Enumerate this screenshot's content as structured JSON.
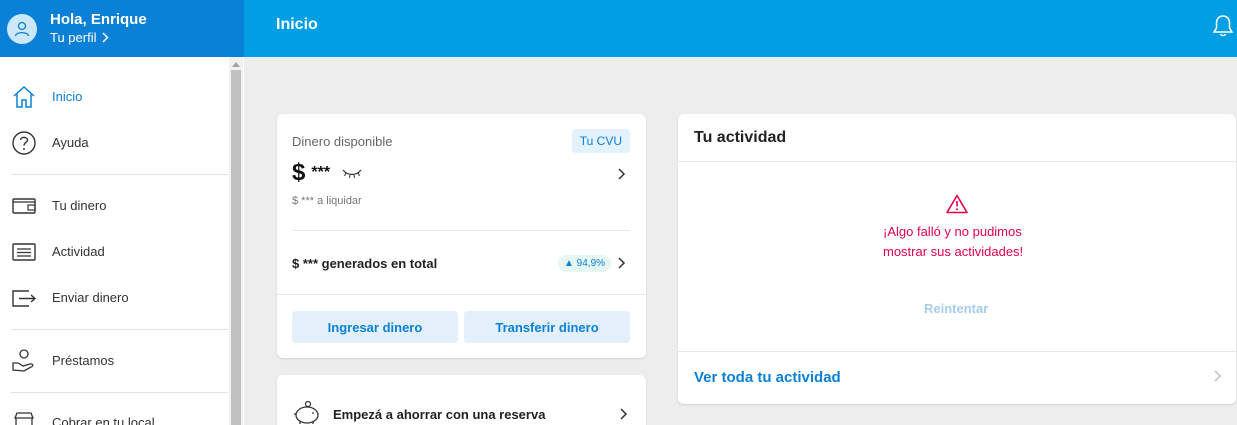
{
  "header": {
    "greeting": "Hola, Enrique",
    "profile_link": "Tu perfil",
    "page_title": "Inicio"
  },
  "sidebar": {
    "items": [
      {
        "label": "Inicio",
        "icon": "home-icon",
        "active": true
      },
      {
        "label": "Ayuda",
        "icon": "help-icon"
      },
      {
        "label": "Tu dinero",
        "icon": "wallet-icon"
      },
      {
        "label": "Actividad",
        "icon": "activity-icon"
      },
      {
        "label": "Enviar dinero",
        "icon": "send-money-icon"
      },
      {
        "label": "Préstamos",
        "icon": "loans-icon"
      },
      {
        "label": "Cobrar en tu local",
        "icon": "store-icon"
      }
    ]
  },
  "money_card": {
    "label": "Dinero disponible",
    "cvu_badge": "Tu CVU",
    "balance_symbol": "$",
    "balance_mask": "***",
    "pending": "$ *** a liquidar",
    "generated": "$ *** generados en total",
    "percent": "▲ 94,9%",
    "deposit_button": "Ingresar dinero",
    "transfer_button": "Transferir dinero"
  },
  "savings_card": {
    "label": "Empezá a ahorrar con una reserva"
  },
  "activity_card": {
    "title": "Tu actividad",
    "error": "¡Algo falló y no pudimos mostrar sus actividades!",
    "retry": "Reintentar",
    "see_all": "Ver toda tu actividad"
  },
  "colors": {
    "header_blue": "#009ee3",
    "profile_blue": "#0a80d6",
    "error_red": "#e3004f"
  }
}
